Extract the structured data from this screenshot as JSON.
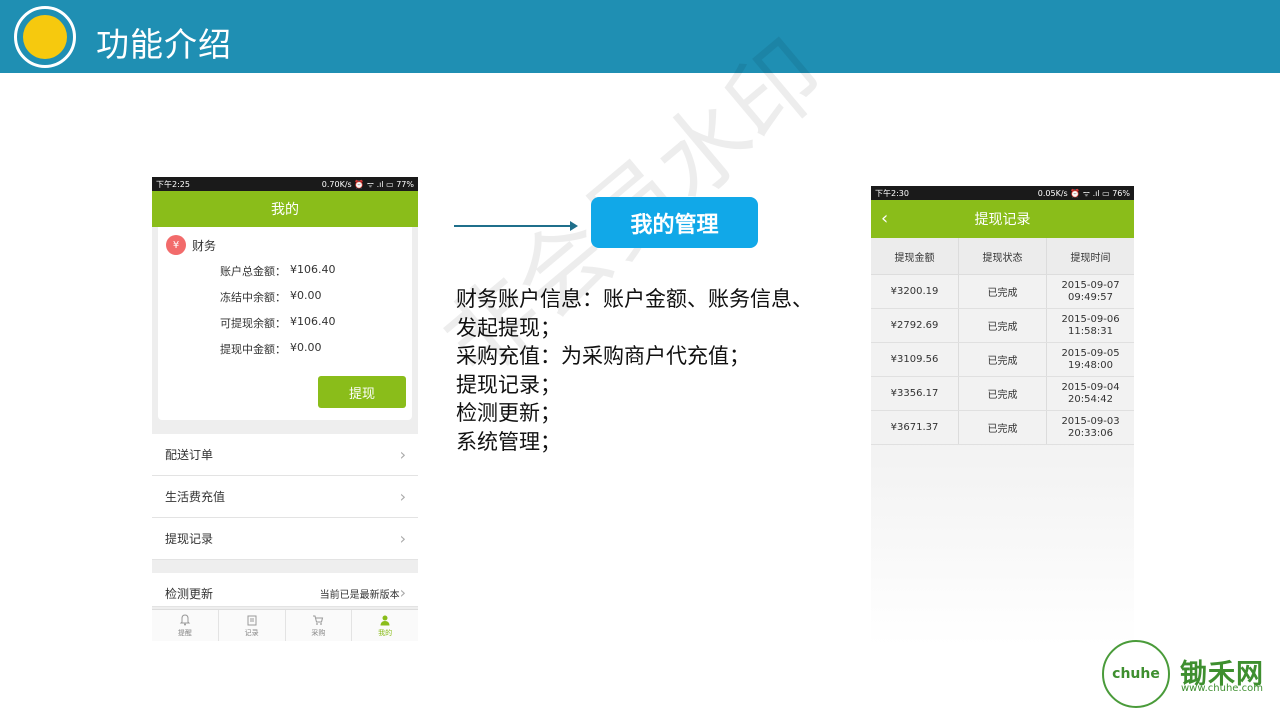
{
  "header": {
    "title": "功能介绍"
  },
  "watermark": "非会员水印",
  "phone1": {
    "status_left": "下午2:25",
    "status_right": "0.70K/s ⏰ ᯤ .ıl ▭ 77%",
    "title": "我的",
    "finance": {
      "icon_text": "¥",
      "title": "财务",
      "rows": [
        {
          "label": "账户总金额：",
          "value": "¥106.40"
        },
        {
          "label": "冻结中余额：",
          "value": "¥0.00"
        },
        {
          "label": "可提现余额：",
          "value": "¥106.40"
        },
        {
          "label": "提现中金额：",
          "value": "¥0.00"
        }
      ],
      "withdraw_label": "提现"
    },
    "menu": [
      {
        "label": "配送订单"
      },
      {
        "label": "生活费充值"
      },
      {
        "label": "提现记录"
      }
    ],
    "update": {
      "label": "检测更新",
      "status": "当前已是最新版本"
    },
    "tabs": [
      {
        "label": "提醒",
        "icon": "bell-icon"
      },
      {
        "label": "记录",
        "icon": "clipboard-icon"
      },
      {
        "label": "采购",
        "icon": "cart-icon"
      },
      {
        "label": "我的",
        "icon": "user-icon"
      }
    ]
  },
  "middle": {
    "badge": "我的管理",
    "lines": [
      "财务账户信息：账户金额、账务信息、",
      "发起提现；",
      "采购充值：为采购商户代充值；",
      "提现记录；",
      "检测更新；",
      "系统管理；"
    ]
  },
  "phone2": {
    "status_left": "下午2:30",
    "status_right": "0.05K/s ⏰ ᯤ .ıl ▭ 76%",
    "title": "提现记录",
    "columns": [
      "提现金额",
      "提现状态",
      "提现时间"
    ],
    "rows": [
      {
        "amount": "¥3200.19",
        "status": "已完成",
        "date": "2015-09-07",
        "time": "09:49:57"
      },
      {
        "amount": "¥2792.69",
        "status": "已完成",
        "date": "2015-09-06",
        "time": "11:58:31"
      },
      {
        "amount": "¥3109.56",
        "status": "已完成",
        "date": "2015-09-05",
        "time": "19:48:00"
      },
      {
        "amount": "¥3356.17",
        "status": "已完成",
        "date": "2015-09-04",
        "time": "20:54:42"
      },
      {
        "amount": "¥3671.37",
        "status": "已完成",
        "date": "2015-09-03",
        "time": "20:33:06"
      }
    ]
  },
  "brand": {
    "mark": "chuhe",
    "name": "锄禾网",
    "url": "www.chuhe.com"
  }
}
